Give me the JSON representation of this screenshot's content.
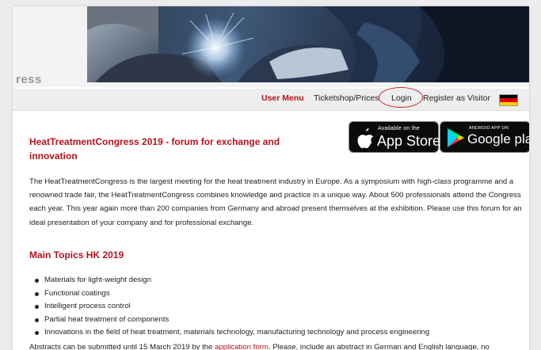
{
  "header": {
    "site_logo_partial": "ress"
  },
  "nav": {
    "user_menu": "User Menu",
    "ticketshop": "Ticketshop/Prices",
    "login": "Login",
    "register": "Register as Visitor",
    "language_flag": "german-flag-icon",
    "flag_colors": [
      "#000000",
      "#dd0000",
      "#ffce00"
    ],
    "highlight_color": "#c8262e"
  },
  "badges": {
    "apple_small": "Available on the",
    "apple_big": "App Store",
    "google_small": "ANDROID APP ON",
    "google_big": "Google play"
  },
  "main": {
    "title": "HeatTreatmentCongress 2019 - forum for exchange and innovation",
    "intro": "The HeatTreatmentCongress is the largest meeting for the heat treatment industry in Europe. As a symposium with high-class programme and a renowned trade fair, the HeatTreatmentCongress combines knowledge and practice in a unique way. About 500 professionals attend the Congress each year. This year again more than 200 companies from Germany and abroad present themselves at the exhibition. Please use this forum for an ideal presentation of your company and for professional exchange.",
    "subheading": "Main Topics HK 2019",
    "topics": [
      "Materials for light-weight design",
      "Functional coatings",
      "Intelligent process control",
      "Partial heat treatment of components",
      "Innovations in the field of heat treatment, materials technology, manufacturing technology and process engineering"
    ],
    "footer_before": "Abstracts can be submitted until 15 March 2019 by the ",
    "footer_link": "application form",
    "footer_after": ". Please, include an abstract in German and English language, no"
  },
  "colors": {
    "accent_red": "#b5121b",
    "text": "#222222"
  }
}
